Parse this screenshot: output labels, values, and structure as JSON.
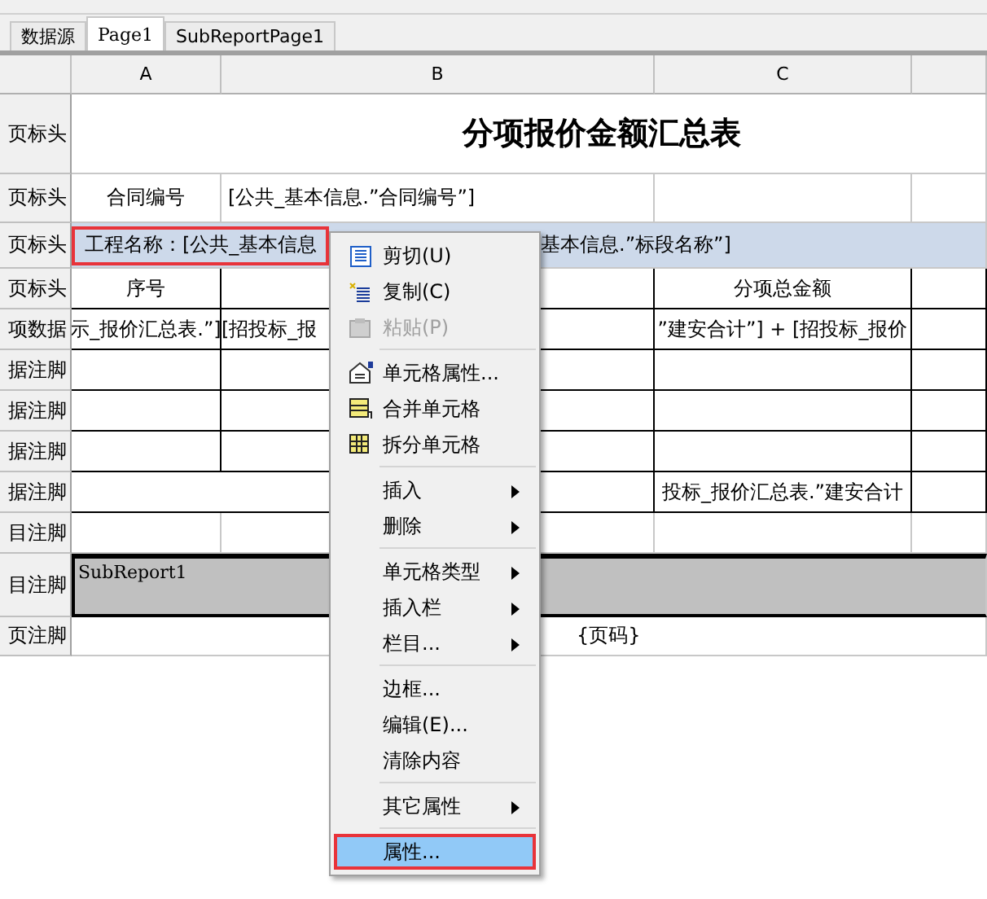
{
  "tabs": [
    {
      "label": "数据源",
      "selected": false
    },
    {
      "label": "Page1",
      "selected": true
    },
    {
      "label": "SubReportPage1",
      "selected": false
    }
  ],
  "columns": [
    "A",
    "B",
    "C"
  ],
  "rows": [
    {
      "header": "页标头",
      "kind": "title",
      "selected": false,
      "title": "分项报价金额汇总表"
    },
    {
      "header": "页标头",
      "kind": "field",
      "selected": false,
      "label": "合同编号",
      "value": "[公共_基本信息.”合同编号”]"
    },
    {
      "header": "页标头",
      "kind": "band",
      "selected": true,
      "marked": true,
      "left": "工程名称：[公共_基本信息",
      "right": "基本信息.”标段名称”]"
    },
    {
      "header": "页标头",
      "kind": "grid",
      "selected": false,
      "col_a": "序号",
      "col_c": "分项总金额"
    },
    {
      "header": "项数据",
      "kind": "grid",
      "selected": false,
      "col_a": "示_报价汇总表.”]",
      "col_b": "[招投标_报",
      "col_c": "”建安合计”] + [招投标_报价"
    },
    {
      "header": "据注脚",
      "kind": "grid",
      "selected": false
    },
    {
      "header": "据注脚",
      "kind": "grid",
      "selected": false
    },
    {
      "header": "据注脚",
      "kind": "grid",
      "selected": false
    },
    {
      "header": "据注脚",
      "kind": "merged",
      "selected": false,
      "col_c": "投标_报价汇总表.”建安合计"
    },
    {
      "header": "目注脚",
      "kind": "empty",
      "selected": false
    },
    {
      "header": "目注脚",
      "kind": "subreport",
      "selected": false,
      "subreport": "SubReport1"
    },
    {
      "header": "页注脚",
      "kind": "footer",
      "selected": false,
      "page_field": "{页码}"
    }
  ],
  "context_menu": [
    {
      "kind": "item",
      "label": "剪切(U)",
      "disabled": false,
      "submenu": false,
      "selected": false
    },
    {
      "kind": "item",
      "label": "复制(C)",
      "disabled": false,
      "submenu": false,
      "selected": false
    },
    {
      "kind": "item",
      "label": "粘贴(P)",
      "disabled": true,
      "submenu": false,
      "selected": false
    },
    {
      "kind": "separator"
    },
    {
      "kind": "item",
      "label": "单元格属性...",
      "disabled": false,
      "submenu": false,
      "selected": false
    },
    {
      "kind": "item",
      "label": "合并单元格",
      "disabled": false,
      "submenu": false,
      "selected": false
    },
    {
      "kind": "item",
      "label": "拆分单元格",
      "disabled": false,
      "submenu": false,
      "selected": false
    },
    {
      "kind": "separator"
    },
    {
      "kind": "item",
      "label": "插入",
      "disabled": false,
      "submenu": true,
      "selected": false
    },
    {
      "kind": "item",
      "label": "删除",
      "disabled": false,
      "submenu": true,
      "selected": false
    },
    {
      "kind": "separator"
    },
    {
      "kind": "item",
      "label": "单元格类型",
      "disabled": false,
      "submenu": true,
      "selected": false
    },
    {
      "kind": "item",
      "label": "插入栏",
      "disabled": false,
      "submenu": true,
      "selected": false
    },
    {
      "kind": "item",
      "label": "栏目...",
      "disabled": false,
      "submenu": true,
      "selected": false
    },
    {
      "kind": "separator"
    },
    {
      "kind": "item",
      "label": "边框...",
      "disabled": false,
      "submenu": false,
      "selected": false
    },
    {
      "kind": "item",
      "label": "编辑(E)...",
      "disabled": false,
      "submenu": false,
      "selected": false
    },
    {
      "kind": "item",
      "label": "清除内容",
      "disabled": false,
      "submenu": false,
      "selected": false
    },
    {
      "kind": "separator"
    },
    {
      "kind": "item",
      "label": "其它属性",
      "disabled": false,
      "submenu": true,
      "selected": false
    },
    {
      "kind": "separator"
    },
    {
      "kind": "item",
      "label": "属性...",
      "disabled": false,
      "submenu": false,
      "selected": true,
      "marked": true
    }
  ]
}
